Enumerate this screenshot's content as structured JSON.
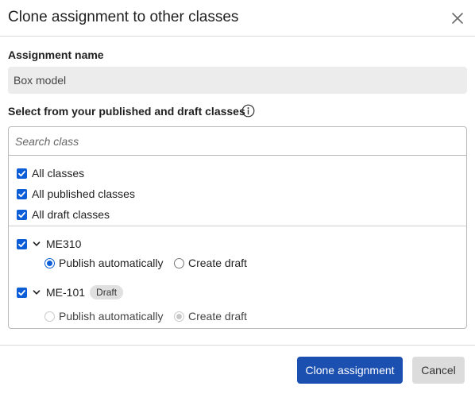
{
  "dialog": {
    "title": "Clone assignment to other classes"
  },
  "assignment": {
    "label": "Assignment name",
    "value": "Box model"
  },
  "classes_section": {
    "label": "Select from your published and draft classes",
    "search_placeholder": "Search class",
    "groups": [
      {
        "label": "All classes",
        "checked": true
      },
      {
        "label": "All published classes",
        "checked": true
      },
      {
        "label": "All draft classes",
        "checked": true
      }
    ],
    "classes": [
      {
        "name": "ME310",
        "checked": true,
        "badge": "",
        "options": [
          {
            "label": "Publish automatically",
            "selected": true,
            "disabled": false
          },
          {
            "label": "Create draft",
            "selected": false,
            "disabled": false
          }
        ]
      },
      {
        "name": "ME-101",
        "checked": true,
        "badge": "Draft",
        "options": [
          {
            "label": "Publish automatically",
            "selected": false,
            "disabled": true
          },
          {
            "label": "Create draft",
            "selected": true,
            "disabled": true
          }
        ]
      }
    ]
  },
  "footer": {
    "primary_label": "Clone assignment",
    "secondary_label": "Cancel"
  },
  "colors": {
    "accent": "#0b5ed7",
    "primary_button": "#1b4fb0",
    "secondary_button": "#dcdcdc"
  },
  "icons": {
    "close": "close-icon",
    "info": "info-icon",
    "expand": "chevron-down-icon",
    "check": "checkmark-icon"
  }
}
